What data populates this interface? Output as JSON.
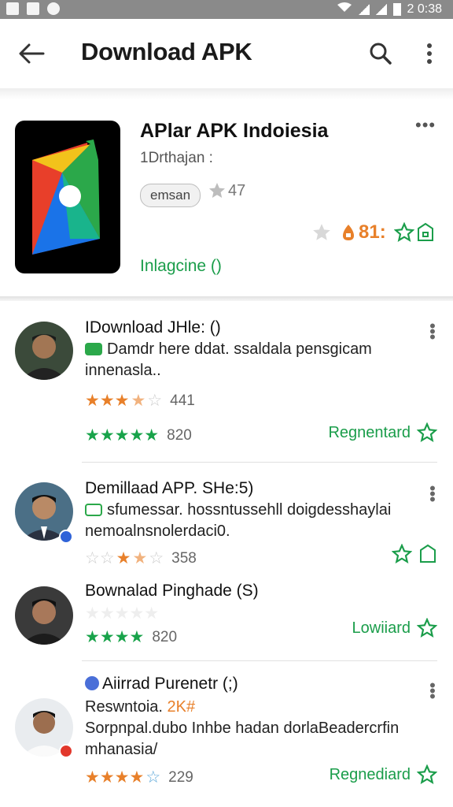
{
  "status_bar": {
    "time": "2 0:38"
  },
  "app_bar": {
    "title": "Download APK"
  },
  "app": {
    "name": "APlar APK Indoiesia",
    "subtitle": "1Drthajan :",
    "chip": "emsan",
    "small_rating": "47",
    "score": "81:",
    "link": "Inlagcine ()",
    "more": "•••"
  },
  "colors": {
    "accent_green": "#1a9d4a",
    "star_orange": "#e8802a",
    "star_green": "#18a34a"
  },
  "reviews": [
    {
      "title": "IDownload JHle: ()",
      "text": "Damdr here ddat. ssaldala pensgicam innenasla..",
      "stars_a": {
        "rating": 3.5,
        "count": "441"
      },
      "stars_b": {
        "rating": 5,
        "count": "820"
      },
      "action": "Regnentard"
    },
    {
      "title": "Demillaad APP. SHe:5)",
      "text": "sfumessar. hossntussehll doigdesshaylai nemoalnsnolerdaci0.",
      "stars_a": {
        "rating": 2.5,
        "count": "358"
      }
    },
    {
      "title": "Bownalad Pinghade (S)",
      "stars_b": {
        "rating": 4,
        "count": "820"
      },
      "action": "Lowiiard"
    },
    {
      "title": "Aiirrad Purenetr (;)",
      "subtitle": "Reswntoia. ",
      "subtitle_highlight": "2K#",
      "text": "Sorpnpal.dubo Inhbe hadan dorlaBeadercrfin mhanasia/",
      "stars_a": {
        "rating": 4,
        "count": "229"
      },
      "action": "Regnediard"
    }
  ]
}
